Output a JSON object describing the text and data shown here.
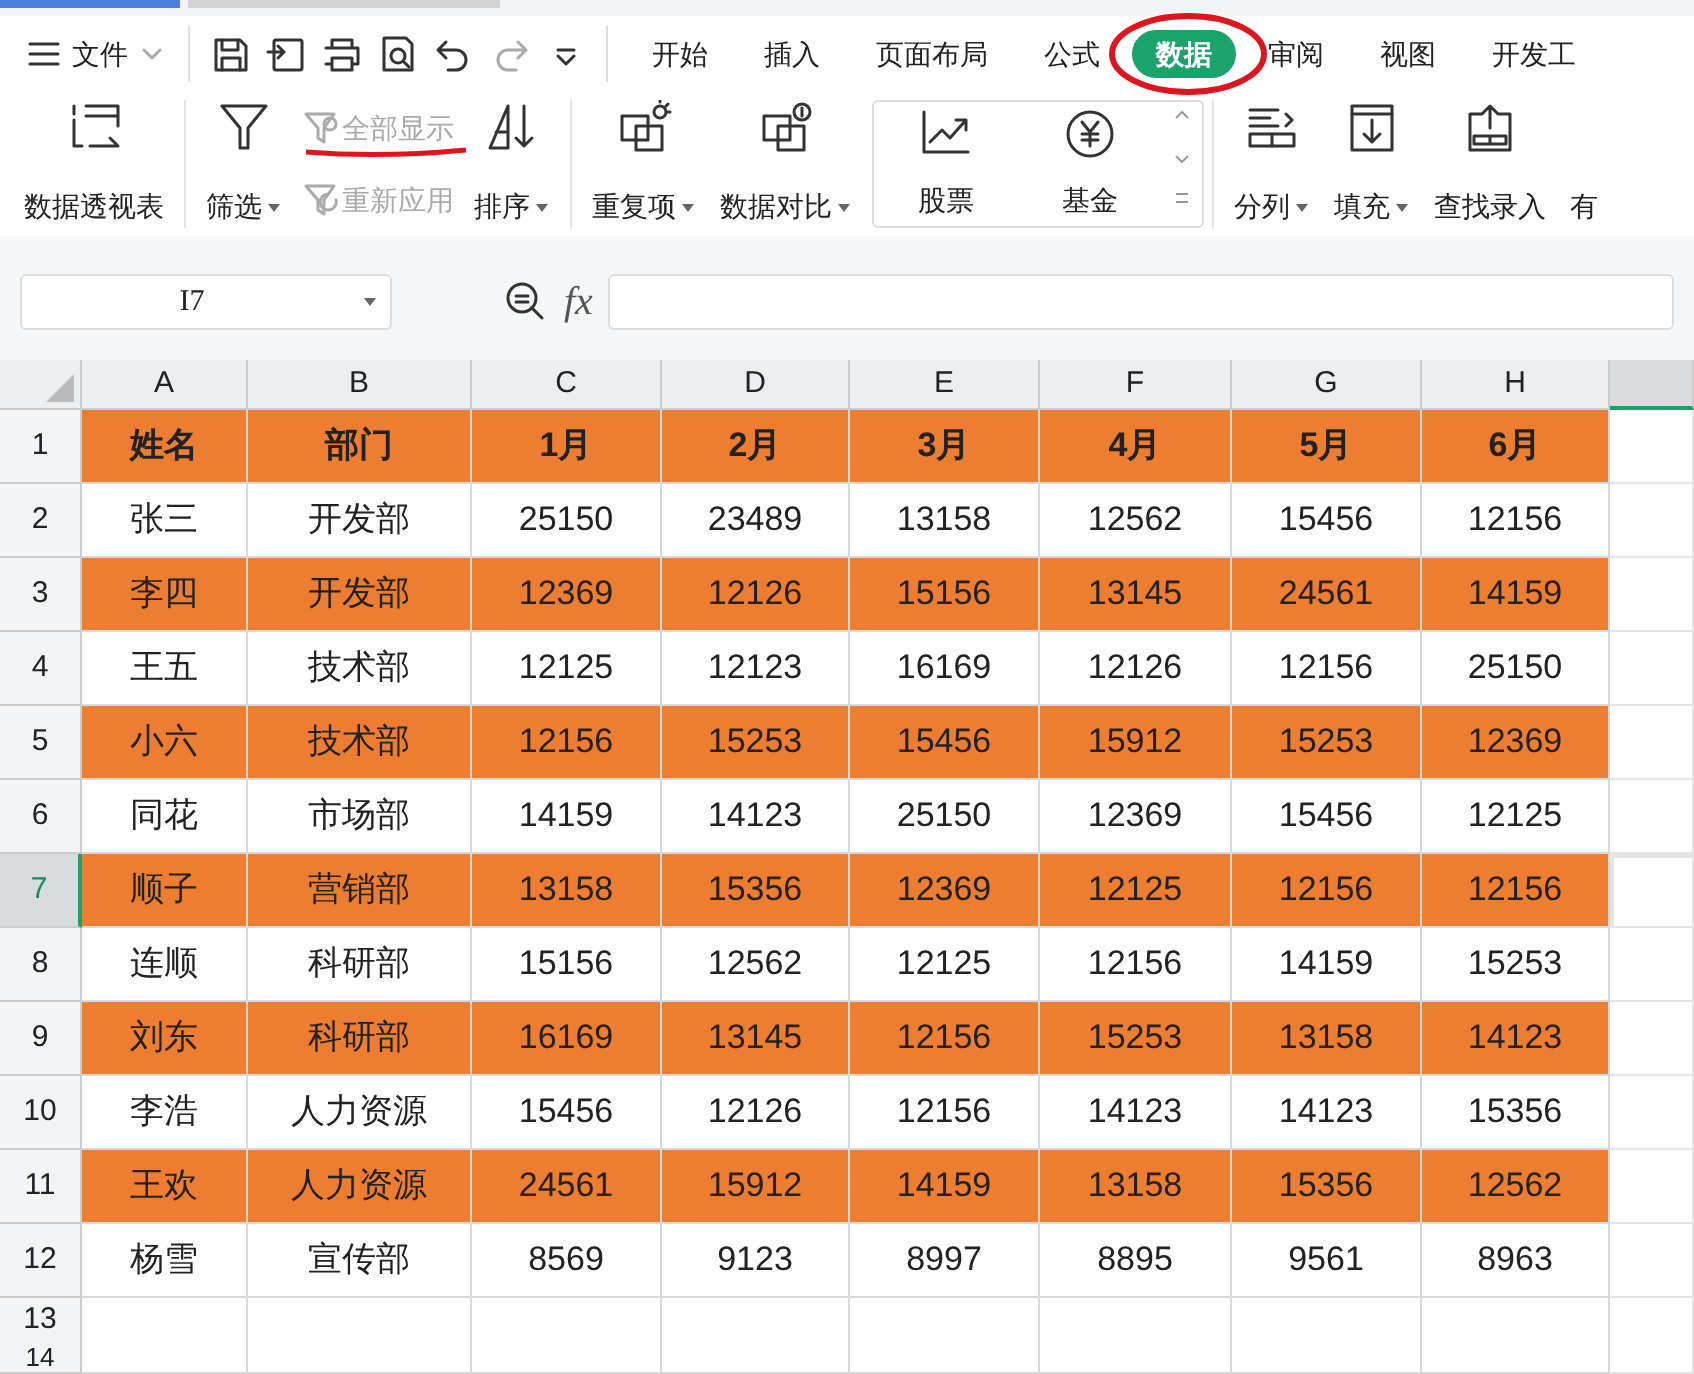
{
  "menu": {
    "file_label": "文件",
    "quick_access": [
      {
        "kind": "save",
        "disabled": false
      },
      {
        "kind": "export",
        "disabled": false
      },
      {
        "kind": "print",
        "disabled": false
      },
      {
        "kind": "preview",
        "disabled": false
      },
      {
        "kind": "undo",
        "disabled": false
      },
      {
        "kind": "redo",
        "disabled": true
      },
      {
        "kind": "more",
        "disabled": false
      }
    ],
    "tabs": [
      {
        "label": "开始",
        "selected": false,
        "circled": false
      },
      {
        "label": "插入",
        "selected": false,
        "circled": false
      },
      {
        "label": "页面布局",
        "selected": false,
        "circled": false
      },
      {
        "label": "公式",
        "selected": false,
        "circled": false
      },
      {
        "label": "数据",
        "selected": true,
        "circled": true
      },
      {
        "label": "审阅",
        "selected": false,
        "circled": false
      },
      {
        "label": "视图",
        "selected": false,
        "circled": false
      },
      {
        "label": "开发工",
        "selected": false,
        "circled": false
      }
    ]
  },
  "ribbon": [
    {
      "kind": "large",
      "label": "数据透视表",
      "dropdown": false
    },
    {
      "kind": "large",
      "label": "筛选",
      "dropdown": true
    },
    {
      "kind": "stack",
      "items": [
        {
          "label": "全部显示",
          "disabled": true,
          "underlined": true
        },
        {
          "label": "重新应用",
          "disabled": true,
          "underlined": false
        }
      ]
    },
    {
      "kind": "large",
      "label": "排序",
      "dropdown": true
    },
    {
      "kind": "large",
      "label": "重复项",
      "dropdown": true
    },
    {
      "kind": "large",
      "label": "数据对比",
      "dropdown": true
    },
    {
      "kind": "gallery",
      "items": [
        {
          "label": "股票"
        },
        {
          "label": "基金"
        }
      ]
    },
    {
      "kind": "large",
      "label": "分列",
      "dropdown": true
    },
    {
      "kind": "large",
      "label": "填充",
      "dropdown": true
    },
    {
      "kind": "large",
      "label": "查找录入",
      "dropdown": false
    },
    {
      "kind": "large",
      "label": "有",
      "dropdown": false
    }
  ],
  "name_box": {
    "value": "I7"
  },
  "formula_bar": {
    "fx": "fx"
  },
  "sheet": {
    "columns": [
      {
        "label": "A",
        "selected": false
      },
      {
        "label": "B",
        "selected": false
      },
      {
        "label": "C",
        "selected": false
      },
      {
        "label": "D",
        "selected": false
      },
      {
        "label": "E",
        "selected": false
      },
      {
        "label": "F",
        "selected": false
      },
      {
        "label": "G",
        "selected": false
      },
      {
        "label": "H",
        "selected": false
      },
      {
        "selected": true
      }
    ],
    "rows": [
      {
        "number": "1",
        "kind": "header",
        "highlighted": true,
        "selected": false,
        "cells": [
          "姓名",
          "部门",
          "1月",
          "2月",
          "3月",
          "4月",
          "5月",
          "6月"
        ]
      },
      {
        "number": "2",
        "kind": "data",
        "highlighted": false,
        "selected": false,
        "cells": [
          "张三",
          "开发部",
          "25150",
          "23489",
          "13158",
          "12562",
          "15456",
          "12156"
        ]
      },
      {
        "number": "3",
        "kind": "data",
        "highlighted": true,
        "selected": false,
        "cells": [
          "李四",
          "开发部",
          "12369",
          "12126",
          "15156",
          "13145",
          "24561",
          "14159"
        ]
      },
      {
        "number": "4",
        "kind": "data",
        "highlighted": false,
        "selected": false,
        "cells": [
          "王五",
          "技术部",
          "12125",
          "12123",
          "16169",
          "12126",
          "12156",
          "25150"
        ]
      },
      {
        "number": "5",
        "kind": "data",
        "highlighted": true,
        "selected": false,
        "cells": [
          "小六",
          "技术部",
          "12156",
          "15253",
          "15456",
          "15912",
          "15253",
          "12369"
        ]
      },
      {
        "number": "6",
        "kind": "data",
        "highlighted": false,
        "selected": false,
        "cells": [
          "同花",
          "市场部",
          "14159",
          "14123",
          "25150",
          "12369",
          "15456",
          "12125"
        ]
      },
      {
        "number": "7",
        "kind": "data",
        "highlighted": true,
        "selected": true,
        "cells": [
          "顺子",
          "营销部",
          "13158",
          "15356",
          "12369",
          "12125",
          "12156",
          "12156"
        ]
      },
      {
        "number": "8",
        "kind": "data",
        "highlighted": false,
        "selected": false,
        "cells": [
          "连顺",
          "科研部",
          "15156",
          "12562",
          "12125",
          "12156",
          "14159",
          "15253"
        ]
      },
      {
        "number": "9",
        "kind": "data",
        "highlighted": true,
        "selected": false,
        "cells": [
          "刘东",
          "科研部",
          "16169",
          "13145",
          "12156",
          "15253",
          "13158",
          "14123"
        ]
      },
      {
        "number": "10",
        "kind": "data",
        "highlighted": false,
        "selected": false,
        "cells": [
          "李浩",
          "人力资源",
          "15456",
          "12126",
          "12156",
          "14123",
          "14123",
          "15356"
        ]
      },
      {
        "number": "11",
        "kind": "data",
        "highlighted": true,
        "selected": false,
        "cells": [
          "王欢",
          "人力资源",
          "24561",
          "15912",
          "14159",
          "13158",
          "15356",
          "12562"
        ]
      },
      {
        "number": "12",
        "kind": "data",
        "highlighted": false,
        "selected": false,
        "cells": [
          "杨雪",
          "宣传部",
          "8569",
          "9123",
          "8997",
          "8895",
          "9561",
          "8963"
        ]
      },
      {
        "number": "13",
        "kind": "empty",
        "highlighted": false,
        "selected": false,
        "cells": []
      },
      {
        "number": "14",
        "kind": "empty",
        "highlighted": false,
        "selected": false,
        "cells": []
      }
    ]
  }
}
